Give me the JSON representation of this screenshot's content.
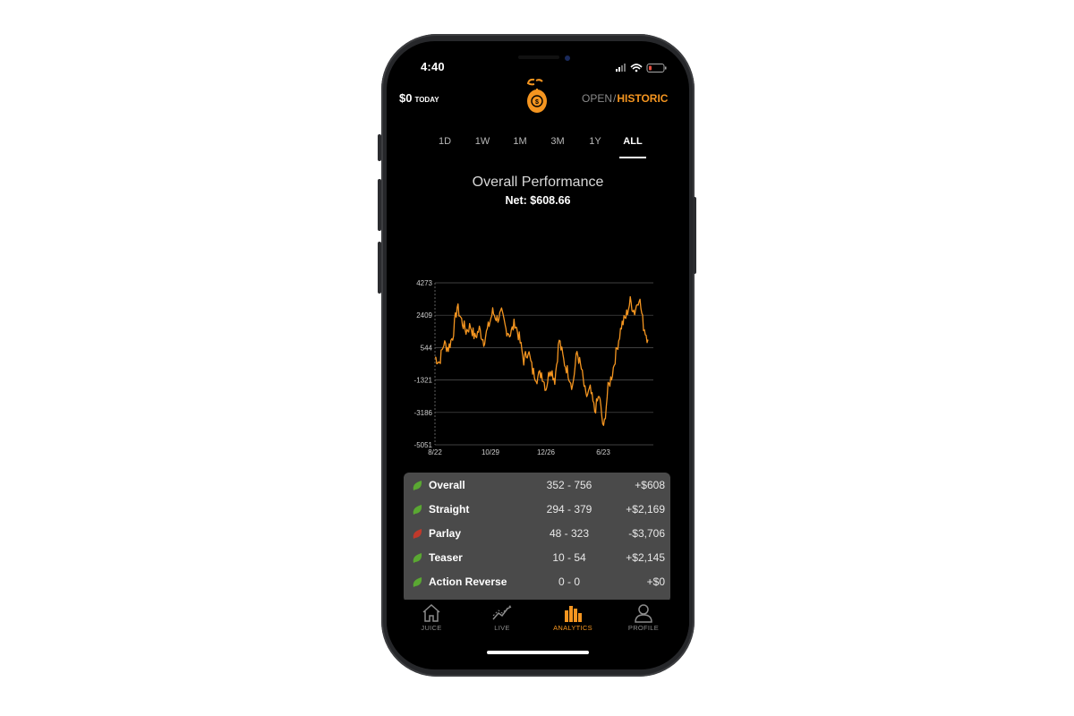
{
  "status": {
    "time": "4:40"
  },
  "header": {
    "balance": "$0",
    "balance_suffix": "TODAY",
    "toggle_open": "OPEN",
    "toggle_separator": "/",
    "toggle_historic": "HISTORIC"
  },
  "range_tabs": [
    "1D",
    "1W",
    "1M",
    "3M",
    "1Y",
    "ALL"
  ],
  "active_range": "ALL",
  "performance": {
    "title": "Overall Performance",
    "net": "Net: $608.66"
  },
  "chart_data": {
    "type": "line",
    "ylim": [
      -5051,
      4273
    ],
    "y_ticks": [
      "4273",
      "2409",
      "544",
      "-1321",
      "-3186",
      "-5051"
    ],
    "x_ticks": [
      "8/22",
      "10/29",
      "12/26",
      "6/23"
    ],
    "series": [
      {
        "color": "#f49520",
        "values": [
          0,
          -300,
          800,
          500,
          1200,
          2900,
          2100,
          1500,
          1800,
          1100,
          1600,
          900,
          1700,
          2600,
          2200,
          2500,
          1600,
          1300,
          2000,
          1100,
          -200,
          400,
          -800,
          -1200,
          -900,
          -1800,
          -600,
          -1300,
          1000,
          -200,
          -900,
          -1700,
          300,
          -700,
          -2300,
          -1900,
          -3100,
          -2200,
          -4200,
          -1800,
          -900,
          500,
          1800,
          2300,
          3200,
          2600,
          3500,
          1800,
          1000
        ]
      }
    ],
    "grid": true,
    "line_color": "#f49520"
  },
  "stats": [
    {
      "label": "Overall",
      "record": "352 - 756",
      "amount": "+$608",
      "status": "positive"
    },
    {
      "label": "Straight",
      "record": "294 - 379",
      "amount": "+$2,169",
      "status": "positive"
    },
    {
      "label": "Parlay",
      "record": "48 - 323",
      "amount": "-$3,706",
      "status": "negative"
    },
    {
      "label": "Teaser",
      "record": "10 - 54",
      "amount": "+$2,145",
      "status": "positive"
    },
    {
      "label": "Action Reverse",
      "record": "0 - 0",
      "amount": "+$0",
      "status": "positive"
    }
  ],
  "nav": [
    {
      "label": "JUICE",
      "icon": "home-icon",
      "active": false
    },
    {
      "label": "LIVE",
      "icon": "trend-icon",
      "active": false
    },
    {
      "label": "ANALYTICS",
      "icon": "bar-chart-icon",
      "active": true
    },
    {
      "label": "PROFILE",
      "icon": "person-icon",
      "active": false
    }
  ],
  "colors": {
    "accent": "#f49520",
    "positive": "#5aa832",
    "negative": "#c0392b",
    "panel": "#4a4a4a"
  }
}
